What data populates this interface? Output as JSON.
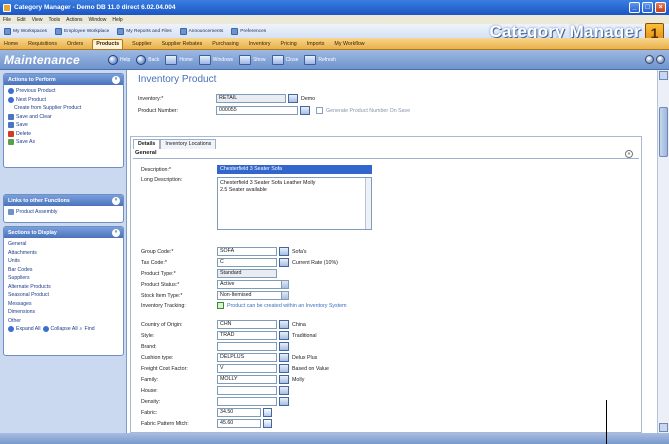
{
  "window": {
    "title": "Category Manager - Demo DB 11.0 direct 6.02.04.004"
  },
  "menu": [
    "File",
    "Edit",
    "View",
    "Tools",
    "Actions",
    "Window",
    "Help"
  ],
  "favorites": [
    "My Workspaces",
    "Employee Workplace",
    "My Reports and Files",
    "Announcements",
    "Preferences"
  ],
  "brand": {
    "name": "Category Manager",
    "logo": "1"
  },
  "tabs": [
    "Home",
    "Requisitions",
    "Orders",
    "Products",
    "Supplier",
    "Supplier Rebates",
    "Purchasing",
    "Inventory",
    "Pricing",
    "Imports",
    "My Workflow"
  ],
  "active_tab": "Products",
  "toolbar": {
    "title": "Maintenance",
    "help": "Help",
    "back": "Back",
    "home": "Home",
    "windows": "Windows",
    "show": "Show",
    "close": "Close",
    "refresh": "Refresh"
  },
  "sidebar": {
    "actions_title": "Actions to Perform",
    "actions": [
      "Previous Product",
      "Next Product",
      "Create from Supplier Product",
      "Save and Clear",
      "Save",
      "Delete",
      "Save As"
    ],
    "links_title": "Links to other Functions",
    "links": [
      "Product Assembly"
    ],
    "sections_title": "Sections to Display",
    "sections": [
      "General",
      "Attachments",
      "Units",
      "Bar Codes",
      "Suppliers",
      "Alternate Products",
      "Seasonal Product",
      "Messages",
      "Dimensions",
      "Other"
    ],
    "footer": {
      "expand": "Expand All",
      "collapse": "Collapse All",
      "find": "Find"
    }
  },
  "main": {
    "page_title": "Inventory Product",
    "inventory_label": "Inventory:*",
    "inventory_value": "RETAIL",
    "inventory_desc": "Demo",
    "product_number_label": "Product Number:",
    "product_number_value": "000055",
    "generate_label": "Generate Product Number On Save",
    "subtabs": [
      "Details",
      "Inventory Locations"
    ],
    "section": "General",
    "description_label": "Description:*",
    "description_value": "Chesterfield 3 Seater Sofa",
    "long_desc_label": "Long Description:",
    "long_desc_line1": "Chesterfield 3 Seater Sofa Leather Molly",
    "long_desc_line2": "2.5 Seater available",
    "group_code_label": "Group Code:*",
    "group_code_value": "SOFA",
    "group_code_desc": "Sofa's",
    "tax_code_label": "Tax Code:*",
    "tax_code_value": "C",
    "tax_code_desc": "Current Rate (10%)",
    "product_type_label": "Product Type:*",
    "product_type_value": "Standard",
    "product_status_label": "Product Status:*",
    "product_status_value": "Active",
    "stock_item_label": "Stock Item Type:*",
    "stock_item_value": "Non-Itemised",
    "inv_tracking_label": "Inventory Tracking:",
    "inv_tracking_text": "Product can be created within an Inventory System",
    "country_label": "Country of Origin:",
    "country_value": "CHN",
    "country_desc": "China",
    "style_label": "Style:",
    "style_value": "TRAD",
    "style_desc": "Traditional",
    "brand_label": "Brand:",
    "brand_value": "",
    "cushion_label": "Cushion type:",
    "cushion_value": "DELPLUS",
    "cushion_desc": "Delux Plus",
    "freight_label": "Freight Cost Factor:",
    "freight_value": "V",
    "freight_desc": "Based on Value",
    "family_label": "Family:",
    "family_value": "MOLLY",
    "family_desc": "Molly",
    "house_label": "House:",
    "house_value": "",
    "density_label": "Density:",
    "density_value": "",
    "fabric_label": "Fabric:",
    "fabric_value": "34.50",
    "fabric_pattern_label": "Fabric Pattern Mtch:",
    "fabric_pattern_value": "45.60"
  }
}
